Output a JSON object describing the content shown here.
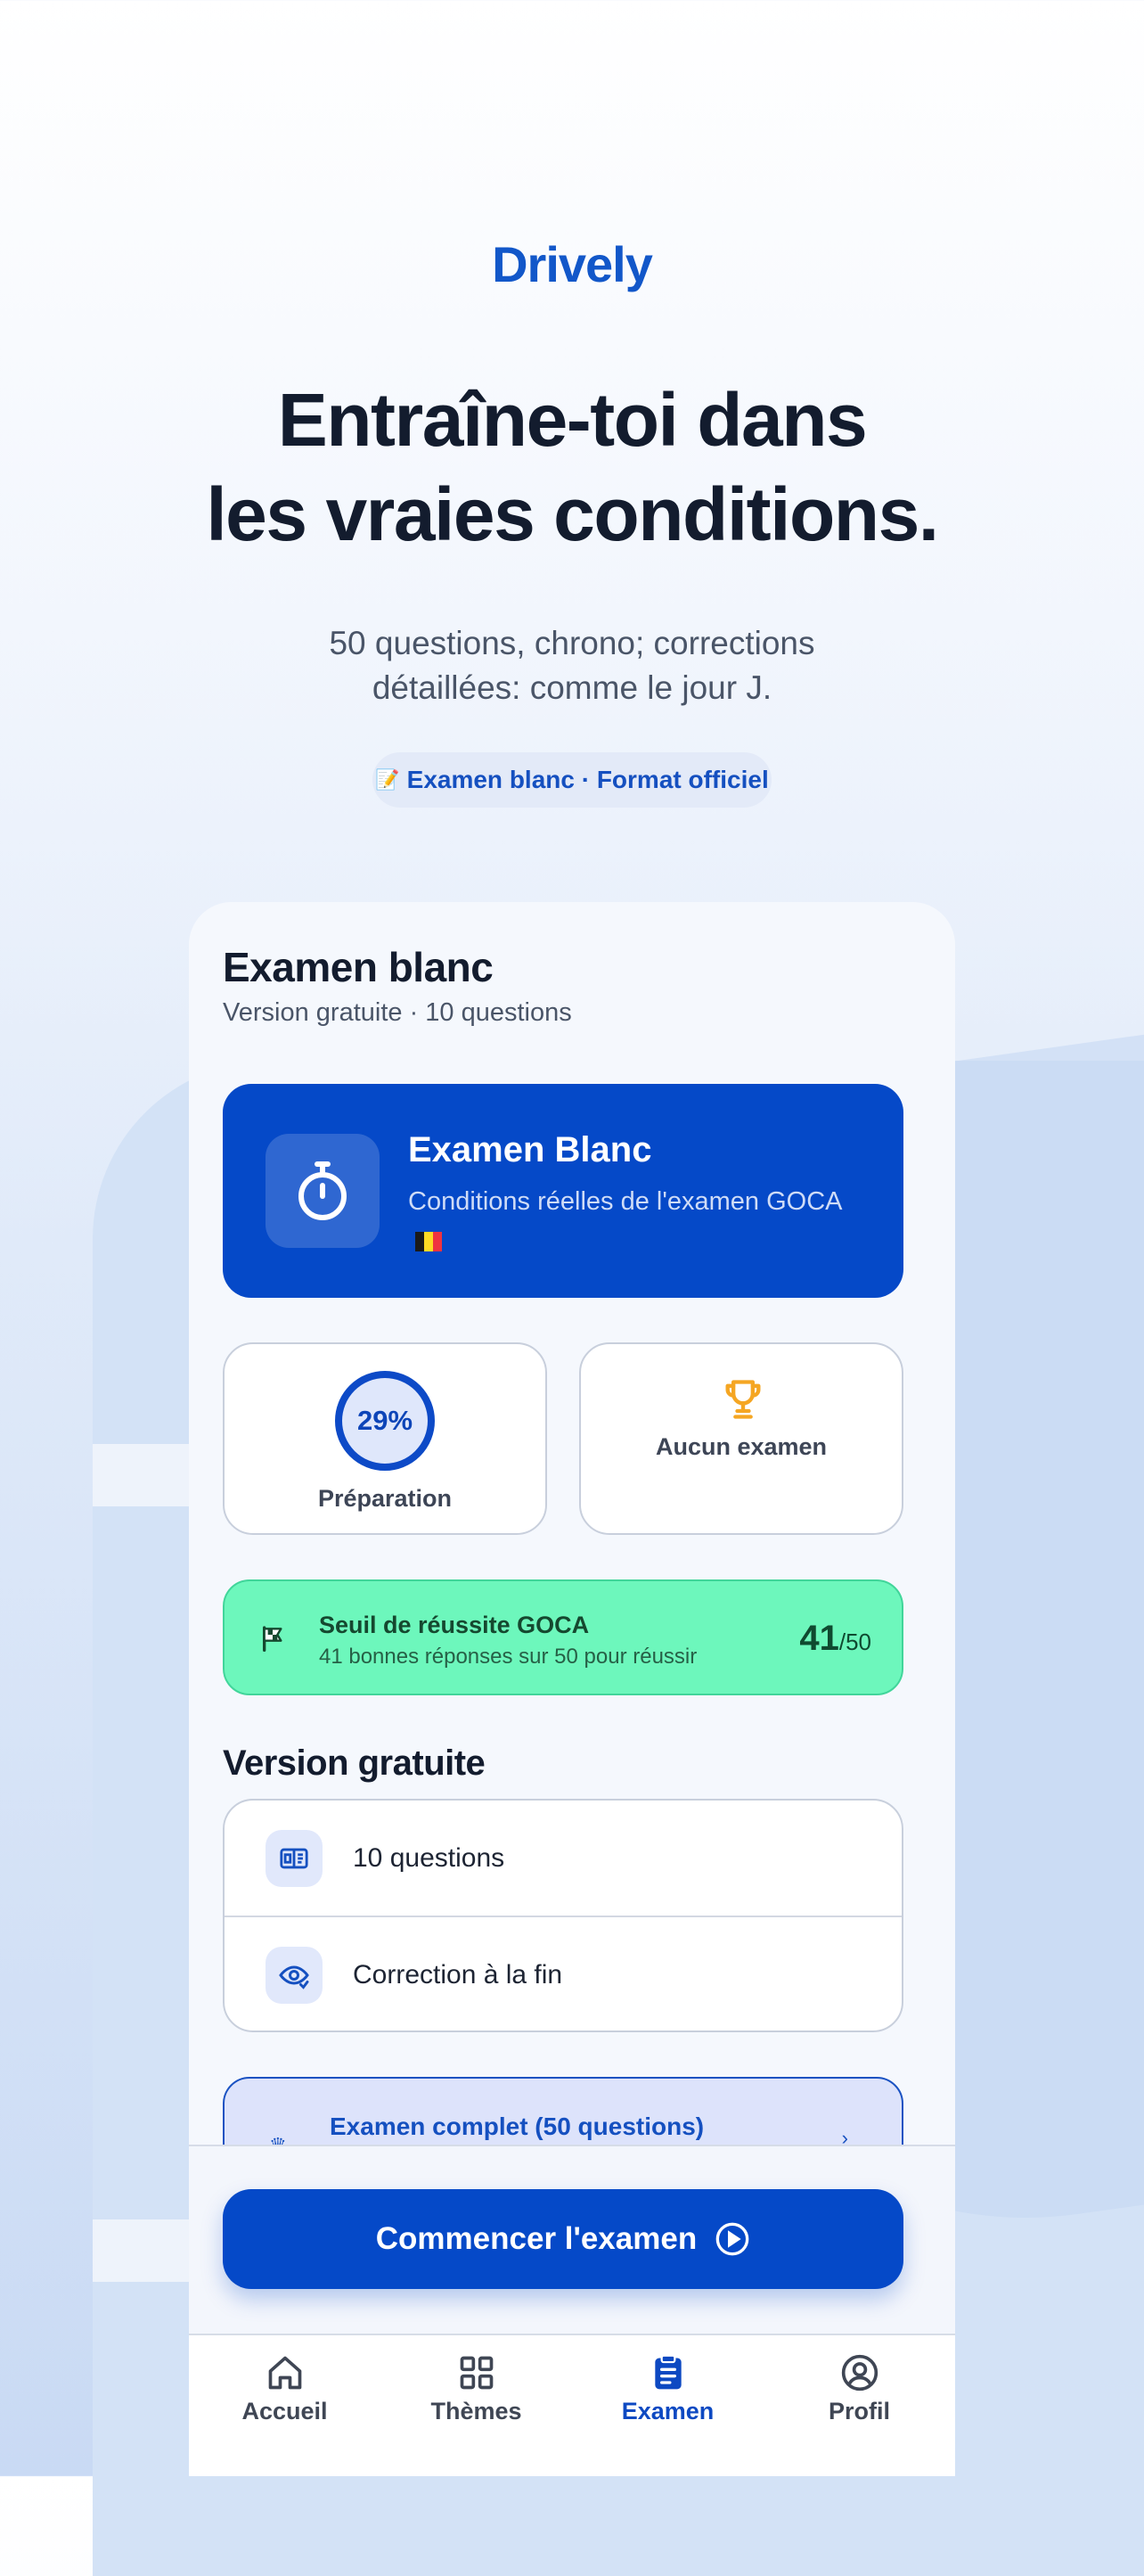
{
  "brand": "Drively",
  "headline": {
    "line1": "Entraîne-toi dans",
    "line2": "les vraies conditions."
  },
  "subline": {
    "line1": "50 questions, chrono; corrections",
    "line2": "détaillées: comme le jour J."
  },
  "badge": {
    "text": "Examen blanc · Format officiel",
    "icon": "pencil-memo-icon"
  },
  "screen": {
    "title": "Examen blanc",
    "subtitle": "Version gratuite · 10 questions",
    "hero_card": {
      "title": "Examen Blanc",
      "description": "Conditions réelles de l'examen GOCA",
      "icon": "stopwatch-icon",
      "flag": "belgium-flag"
    },
    "preparation": {
      "percent": "29%",
      "value": 29,
      "label": "Préparation"
    },
    "exams": {
      "label": "Aucun examen",
      "icon": "trophy-icon"
    },
    "threshold": {
      "title": "Seuil de réussite GOCA",
      "subtitle": "41 bonnes réponses sur 50 pour réussir",
      "score": "41",
      "total": "/50",
      "icon": "checkered-flag-icon"
    },
    "free_version": {
      "title": "Version gratuite",
      "items": [
        {
          "label": "10 questions",
          "icon": "quiz-icon"
        },
        {
          "label": "Correction à la fin",
          "icon": "eye-check-icon"
        }
      ]
    },
    "premium": {
      "label": "Examen complet (50 questions)"
    },
    "start_button": "Commencer l'examen"
  },
  "tabs": [
    {
      "label": "Accueil",
      "icon": "home-icon"
    },
    {
      "label": "Thèmes",
      "icon": "grid-icon"
    },
    {
      "label": "Examen",
      "icon": "clipboard-icon",
      "active": true
    },
    {
      "label": "Profil",
      "icon": "user-circle-icon"
    }
  ],
  "colors": {
    "brand": "#1257c9",
    "primary": "#0549c8",
    "success": "#6df7bc",
    "trophy": "#f5a623"
  }
}
